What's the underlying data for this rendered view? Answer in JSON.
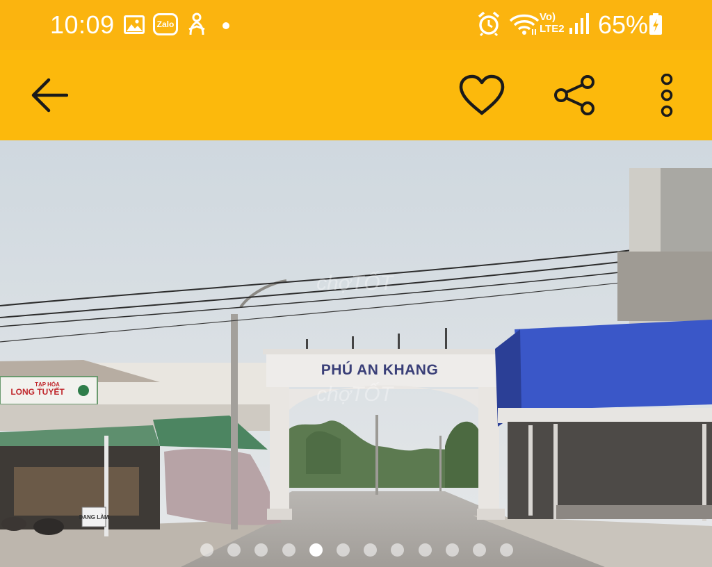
{
  "status_bar": {
    "time": "10:09",
    "zalo_label": "Zalo",
    "network_label": "Vo)\nLTE2",
    "battery_percent": "65%",
    "icons": [
      "gallery-icon",
      "zalo-icon",
      "person-icon",
      "notification-dot",
      "alarm-icon",
      "wifi-icon",
      "volte-icon",
      "signal-icon",
      "battery-charging-icon"
    ]
  },
  "app_bar": {
    "icons": [
      "back-arrow-icon",
      "heart-icon",
      "share-icon",
      "more-vertical-icon"
    ]
  },
  "photo": {
    "gate_sign": "PHÚ AN KHANG",
    "shop_sign_top": "TẠP HÓA",
    "shop_sign_name": "LONG TUYẾT",
    "street_sign": "ĐANG LÀM",
    "watermark": "chợTỐT"
  },
  "gallery": {
    "total_images": 12,
    "current_index": 5
  },
  "colors": {
    "status_bar": "#fbb40f",
    "app_bar": "#fcb90c",
    "icon": "#1a1a1a"
  }
}
